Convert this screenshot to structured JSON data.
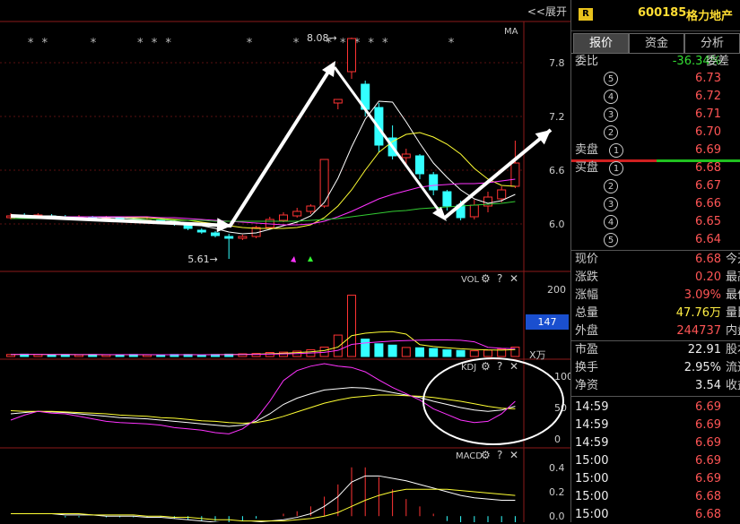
{
  "header": {
    "expand_label": "<<展开",
    "badge": "R",
    "stock_code": "600185",
    "stock_name": "格力地产"
  },
  "tabs": [
    {
      "label": "报价",
      "active": true
    },
    {
      "label": "资金",
      "active": false
    },
    {
      "label": "分析",
      "active": false
    }
  ],
  "order_ratio": {
    "label": "委比",
    "value": "-36.34%",
    "tail": "委差"
  },
  "sell_orders": [
    {
      "label": "",
      "index": "5",
      "price": "6.73"
    },
    {
      "label": "",
      "index": "4",
      "price": "6.72"
    },
    {
      "label": "",
      "index": "3",
      "price": "6.71"
    },
    {
      "label": "",
      "index": "2",
      "price": "6.70"
    },
    {
      "label": "卖盘",
      "index": "1",
      "price": "6.69"
    }
  ],
  "buy_orders": [
    {
      "label": "买盘",
      "index": "1",
      "price": "6.68"
    },
    {
      "label": "",
      "index": "2",
      "price": "6.67"
    },
    {
      "label": "",
      "index": "3",
      "price": "6.66"
    },
    {
      "label": "",
      "index": "4",
      "price": "6.65"
    },
    {
      "label": "",
      "index": "5",
      "price": "6.64"
    }
  ],
  "quote_stats": [
    {
      "label": "现价",
      "value": "6.68",
      "tail": "今开",
      "color": "red"
    },
    {
      "label": "涨跌",
      "value": "0.20",
      "tail": "最高",
      "color": "red"
    },
    {
      "label": "涨幅",
      "value": "3.09%",
      "tail": "最低",
      "color": "red"
    },
    {
      "label": "总量",
      "value": "47.76万",
      "tail": "量比",
      "color": "yellow"
    },
    {
      "label": "外盘",
      "value": "244737",
      "tail": "内盘",
      "color": "red"
    }
  ],
  "fundamentals": [
    {
      "label": "市盈",
      "value": "22.91",
      "tail": "股本"
    },
    {
      "label": "换手",
      "value": "2.95%",
      "tail": "流通"
    },
    {
      "label": "净资",
      "value": "3.54",
      "tail": "收益(四"
    }
  ],
  "ticks": [
    {
      "time": "14:59",
      "price": "6.69"
    },
    {
      "time": "14:59",
      "price": "6.69"
    },
    {
      "time": "14:59",
      "price": "6.69"
    },
    {
      "time": "15:00",
      "price": "6.69"
    },
    {
      "time": "15:00",
      "price": "6.69"
    },
    {
      "time": "15:00",
      "price": "6.68"
    },
    {
      "time": "15:00",
      "price": "6.68"
    }
  ],
  "main_chart": {
    "ma_label": "MA",
    "y_ticks": [
      "7.8",
      "7.2",
      "6.6",
      "6.0"
    ],
    "high_annotation": "8.08→",
    "low_annotation": "5.61→",
    "star_marks": [
      "* *",
      "*",
      "* * *",
      "*",
      "*",
      "* * * * *",
      "*"
    ]
  },
  "vol_panel": {
    "name": "VOL",
    "y_ticks": [
      "200",
      "100"
    ],
    "current_value": "147",
    "unit": "X万"
  },
  "kdj_panel": {
    "name": "KDJ",
    "y_ticks": [
      "100",
      "50",
      "0"
    ]
  },
  "macd_panel": {
    "name": "MACD",
    "y_ticks": [
      "0.4",
      "0.2",
      "0.0"
    ]
  },
  "colors": {
    "up": "#ff3333",
    "down": "#33ffff",
    "ma_white": "#ffffff",
    "ma_yellow": "#ffff33",
    "ma_magenta": "#ff33ff",
    "ma_green": "#33cc33",
    "accent_blue": "#1a4fcf"
  },
  "chart_data": {
    "type": "candlestick",
    "candles": [
      {
        "open": 6.07,
        "close": 6.09,
        "high": 6.12,
        "low": 6.05
      },
      {
        "open": 6.09,
        "close": 6.08,
        "high": 6.12,
        "low": 6.06
      },
      {
        "open": 6.08,
        "close": 6.1,
        "high": 6.12,
        "low": 6.06
      },
      {
        "open": 6.09,
        "close": 6.08,
        "high": 6.11,
        "low": 6.06
      },
      {
        "open": 6.08,
        "close": 6.07,
        "high": 6.1,
        "low": 6.05
      },
      {
        "open": 6.07,
        "close": 6.08,
        "high": 6.1,
        "low": 6.05
      },
      {
        "open": 6.08,
        "close": 6.06,
        "high": 6.09,
        "low": 6.04
      },
      {
        "open": 6.06,
        "close": 6.07,
        "high": 6.09,
        "low": 6.04
      },
      {
        "open": 6.07,
        "close": 6.05,
        "high": 6.08,
        "low": 6.03
      },
      {
        "open": 6.05,
        "close": 6.04,
        "high": 6.07,
        "low": 6.02
      },
      {
        "open": 6.04,
        "close": 6.05,
        "high": 6.07,
        "low": 6.02
      },
      {
        "open": 6.05,
        "close": 6.03,
        "high": 6.06,
        "low": 6.01
      },
      {
        "open": 6.02,
        "close": 6.0,
        "high": 6.04,
        "low": 5.98
      },
      {
        "open": 5.98,
        "close": 5.95,
        "high": 6.0,
        "low": 5.93
      },
      {
        "open": 5.93,
        "close": 5.91,
        "high": 5.95,
        "low": 5.89
      },
      {
        "open": 5.9,
        "close": 5.87,
        "high": 5.92,
        "low": 5.85
      },
      {
        "open": 5.86,
        "close": 5.84,
        "high": 5.89,
        "low": 5.61
      },
      {
        "open": 5.84,
        "close": 5.86,
        "high": 5.88,
        "low": 5.82
      },
      {
        "open": 5.86,
        "close": 5.96,
        "high": 5.98,
        "low": 5.84
      },
      {
        "open": 5.96,
        "close": 6.05,
        "high": 6.08,
        "low": 5.94
      },
      {
        "open": 6.04,
        "close": 6.1,
        "high": 6.13,
        "low": 6.02
      },
      {
        "open": 6.09,
        "close": 6.14,
        "high": 6.18,
        "low": 6.07
      },
      {
        "open": 6.14,
        "close": 6.2,
        "high": 6.22,
        "low": 6.11
      },
      {
        "open": 6.2,
        "close": 6.72,
        "high": 6.72,
        "low": 6.18
      },
      {
        "open": 7.35,
        "close": 7.39,
        "high": 7.39,
        "low": 7.28
      },
      {
        "open": 7.7,
        "close": 8.07,
        "high": 8.08,
        "low": 7.62
      },
      {
        "open": 7.56,
        "close": 7.28,
        "high": 7.6,
        "low": 7.2
      },
      {
        "open": 7.3,
        "close": 6.88,
        "high": 7.35,
        "low": 6.8
      },
      {
        "open": 6.96,
        "close": 6.76,
        "high": 7.1,
        "low": 6.72
      },
      {
        "open": 6.74,
        "close": 6.78,
        "high": 6.84,
        "low": 6.66
      },
      {
        "open": 6.76,
        "close": 6.56,
        "high": 6.78,
        "low": 6.5
      },
      {
        "open": 6.55,
        "close": 6.38,
        "high": 6.58,
        "low": 6.32
      },
      {
        "open": 6.36,
        "close": 6.2,
        "high": 6.38,
        "low": 6.15
      },
      {
        "open": 6.21,
        "close": 6.07,
        "high": 6.26,
        "low": 6.04
      },
      {
        "open": 6.08,
        "close": 6.21,
        "high": 6.27,
        "low": 6.05
      },
      {
        "open": 6.2,
        "close": 6.3,
        "high": 6.36,
        "low": 6.13
      },
      {
        "open": 6.28,
        "close": 6.38,
        "high": 6.42,
        "low": 6.24
      },
      {
        "open": 6.42,
        "close": 6.68,
        "high": 6.93,
        "low": 6.4
      }
    ],
    "ma": [
      {
        "name": "MA5",
        "color": "white",
        "values": [
          6.08,
          6.08,
          6.09,
          6.09,
          6.08,
          6.08,
          6.08,
          6.07,
          6.07,
          6.06,
          6.05,
          6.05,
          6.03,
          6.01,
          5.98,
          5.95,
          5.91,
          5.89,
          5.9,
          5.94,
          5.98,
          6.02,
          6.09,
          6.24,
          6.51,
          6.86,
          7.17,
          7.37,
          7.36,
          7.14,
          6.9,
          6.68,
          6.52,
          6.38,
          6.28,
          6.23,
          6.26,
          6.33
        ]
      },
      {
        "name": "MA10",
        "color": "yellow",
        "values": [
          6.08,
          6.08,
          6.08,
          6.08,
          6.08,
          6.08,
          6.08,
          6.08,
          6.08,
          6.07,
          6.07,
          6.06,
          6.05,
          6.04,
          6.02,
          6.0,
          5.98,
          5.96,
          5.95,
          5.95,
          5.95,
          5.96,
          5.99,
          6.07,
          6.2,
          6.38,
          6.6,
          6.8,
          6.92,
          7.0,
          7.02,
          6.97,
          6.89,
          6.78,
          6.62,
          6.5,
          6.43,
          6.42
        ]
      },
      {
        "name": "MA20",
        "color": "magenta",
        "values": [
          6.08,
          6.08,
          6.08,
          6.08,
          6.08,
          6.08,
          6.08,
          6.08,
          6.08,
          6.08,
          6.08,
          6.07,
          6.07,
          6.06,
          6.05,
          6.04,
          6.03,
          6.02,
          6.01,
          6.0,
          5.99,
          5.99,
          6.0,
          6.03,
          6.08,
          6.14,
          6.21,
          6.28,
          6.33,
          6.37,
          6.41,
          6.43,
          6.44,
          6.45,
          6.45,
          6.46,
          6.48,
          6.5
        ]
      },
      {
        "name": "MA60",
        "color": "green",
        "values": [
          6.06,
          6.06,
          6.06,
          6.06,
          6.06,
          6.06,
          6.06,
          6.05,
          6.05,
          6.05,
          6.05,
          6.05,
          6.04,
          6.04,
          6.04,
          6.03,
          6.03,
          6.03,
          6.03,
          6.03,
          6.03,
          6.03,
          6.04,
          6.05,
          6.06,
          6.08,
          6.1,
          6.12,
          6.14,
          6.15,
          6.17,
          6.18,
          6.19,
          6.2,
          6.21,
          6.22,
          6.23,
          6.25
        ]
      }
    ],
    "volume": [
      6,
      7,
      6,
      5,
      6,
      5,
      6,
      5,
      5,
      6,
      5,
      5,
      6,
      6,
      5,
      6,
      7,
      8,
      9,
      12,
      13,
      16,
      20,
      28,
      64,
      183,
      52,
      38,
      34,
      27,
      26,
      24,
      20,
      18,
      17,
      19,
      22,
      28
    ],
    "vol_ylim": [
      0,
      230
    ],
    "kdj": {
      "k": [
        40,
        42,
        44,
        43,
        42,
        40,
        38,
        36,
        34,
        33,
        32,
        30,
        28,
        26,
        24,
        22,
        20,
        22,
        28,
        40,
        55,
        65,
        72,
        78,
        80,
        82,
        81,
        78,
        74,
        70,
        66,
        60,
        55,
        50,
        46,
        44,
        46,
        52
      ],
      "d": [
        45,
        44,
        44,
        44,
        43,
        42,
        41,
        40,
        38,
        37,
        36,
        34,
        33,
        31,
        29,
        28,
        26,
        25,
        26,
        30,
        36,
        43,
        50,
        57,
        62,
        66,
        68,
        70,
        70,
        69,
        68,
        66,
        63,
        60,
        56,
        52,
        49,
        48
      ],
      "j": [
        30,
        38,
        44,
        41,
        40,
        36,
        32,
        28,
        26,
        25,
        24,
        22,
        18,
        16,
        14,
        10,
        8,
        16,
        32,
        60,
        93,
        109,
        116,
        120,
        116,
        114,
        107,
        94,
        82,
        72,
        62,
        48,
        39,
        30,
        26,
        28,
        40,
        60
      ],
      "ylim": [
        0,
        100
      ]
    },
    "macd": {
      "dif": [
        0.02,
        0.02,
        0.02,
        0.02,
        0.01,
        0.01,
        0.01,
        0.0,
        0.0,
        0.0,
        -0.01,
        -0.01,
        -0.02,
        -0.03,
        -0.04,
        -0.05,
        -0.06,
        -0.06,
        -0.05,
        -0.04,
        -0.03,
        -0.01,
        0.02,
        0.08,
        0.16,
        0.28,
        0.33,
        0.33,
        0.31,
        0.29,
        0.26,
        0.23,
        0.2,
        0.17,
        0.15,
        0.14,
        0.13,
        0.13
      ],
      "dea": [
        0.02,
        0.02,
        0.02,
        0.02,
        0.02,
        0.02,
        0.01,
        0.01,
        0.01,
        0.01,
        0.0,
        0.0,
        -0.01,
        -0.01,
        -0.02,
        -0.03,
        -0.03,
        -0.04,
        -0.04,
        -0.04,
        -0.04,
        -0.03,
        -0.02,
        0.0,
        0.03,
        0.08,
        0.13,
        0.17,
        0.2,
        0.22,
        0.22,
        0.22,
        0.22,
        0.21,
        0.2,
        0.19,
        0.18,
        0.17
      ],
      "hist": [
        0,
        0,
        0,
        0,
        -0.01,
        -0.01,
        0,
        -0.01,
        -0.01,
        -0.01,
        -0.01,
        -0.01,
        -0.02,
        -0.03,
        -0.04,
        -0.04,
        -0.05,
        -0.04,
        -0.02,
        0,
        0.02,
        0.04,
        0.08,
        0.16,
        0.26,
        0.4,
        0.4,
        0.32,
        0.22,
        0.14,
        0.08,
        0.02,
        -0.04,
        -0.08,
        -0.1,
        -0.1,
        -0.1,
        -0.08
      ],
      "ylim": [
        -0.05,
        0.45
      ]
    },
    "price_ylim": [
      5.5,
      8.2
    ]
  }
}
